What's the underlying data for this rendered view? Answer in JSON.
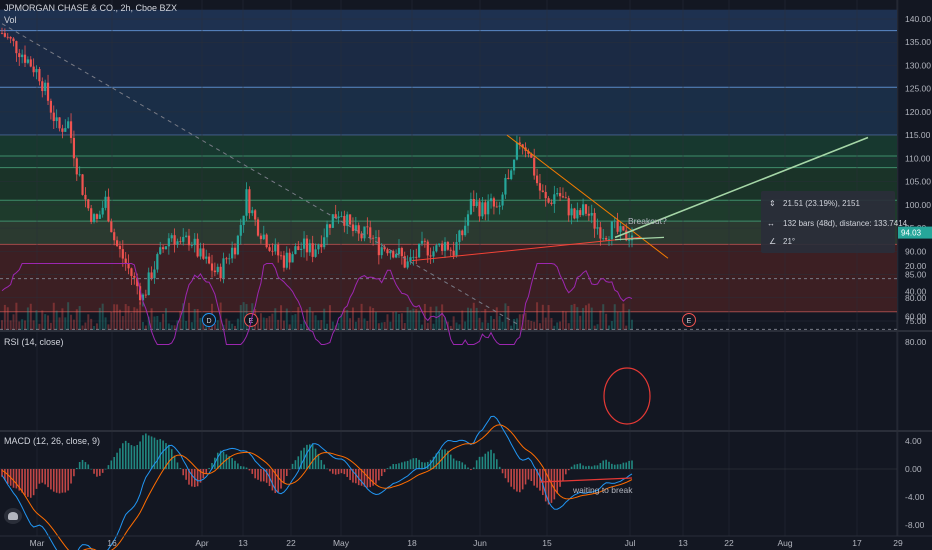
{
  "header": {
    "title": "JPMORGAN CHASE & CO., 2h, Cboe BZX",
    "volume_label": "Vol"
  },
  "rsi": {
    "label": "RSI (14, close)",
    "ticks": [
      "80.00",
      "60.00",
      "40.00",
      "20.00"
    ]
  },
  "macd": {
    "label": "MACD (12, 26, close, 9)",
    "ticks": [
      "4.00",
      "0.00",
      "-4.00",
      "-8.00"
    ],
    "annotation": "waiting to break"
  },
  "price_axis": {
    "ticks": [
      "140.00",
      "135.00",
      "130.00",
      "125.00",
      "120.00",
      "115.00",
      "110.00",
      "105.00",
      "100.00",
      "95.00",
      "90.00",
      "85.00",
      "80.00",
      "75.00"
    ],
    "last_price": "94.03"
  },
  "time_axis": {
    "ticks": [
      "Mar",
      "16",
      "Apr",
      "13",
      "22",
      "May",
      "18",
      "Jun",
      "15",
      "Jul",
      "13",
      "22",
      "Aug",
      "17",
      "29"
    ]
  },
  "annotations": {
    "breakout": "Breakout?"
  },
  "event_markers": [
    "D",
    "E",
    "E"
  ],
  "measure_box": {
    "line1": "21.51 (23.19%), 2151",
    "line2": "132 bars (48d), distance: 133.7414",
    "line3": "21°"
  },
  "colors": {
    "background": "#131722",
    "up": "#26a69a",
    "down": "#ef5350",
    "rsi_line": "#9c27b0",
    "macd_line": "#2196f3",
    "signal_line": "#ff6d00",
    "trend_green": "#a5d6a7",
    "trend_red": "#f44336"
  },
  "chart_data": {
    "type": "candlestick",
    "title": "JPMORGAN CHASE & CO., 2h, Cboe BZX",
    "ylim": [
      73,
      142
    ],
    "x_range": [
      "Mar",
      "29"
    ],
    "close_path": [
      [
        0,
        137
      ],
      [
        0.02,
        133
      ],
      [
        0.04,
        128
      ],
      [
        0.05,
        122
      ],
      [
        0.06,
        116
      ],
      [
        0.07,
        118
      ],
      [
        0.08,
        108
      ],
      [
        0.09,
        100
      ],
      [
        0.1,
        96
      ],
      [
        0.11,
        101
      ],
      [
        0.12,
        92
      ],
      [
        0.13,
        88
      ],
      [
        0.14,
        84
      ],
      [
        0.15,
        80
      ],
      [
        0.16,
        86
      ],
      [
        0.17,
        90
      ],
      [
        0.18,
        94
      ],
      [
        0.19,
        91
      ],
      [
        0.2,
        93
      ],
      [
        0.21,
        89
      ],
      [
        0.22,
        87
      ],
      [
        0.23,
        85
      ],
      [
        0.24,
        89
      ],
      [
        0.25,
        92
      ],
      [
        0.26,
        102
      ],
      [
        0.27,
        96
      ],
      [
        0.28,
        93
      ],
      [
        0.29,
        90
      ],
      [
        0.3,
        88
      ],
      [
        0.31,
        90
      ],
      [
        0.32,
        91
      ],
      [
        0.33,
        90
      ],
      [
        0.34,
        93
      ],
      [
        0.35,
        97
      ],
      [
        0.36,
        99
      ],
      [
        0.37,
        95
      ],
      [
        0.38,
        93
      ],
      [
        0.39,
        94
      ],
      [
        0.4,
        91
      ],
      [
        0.41,
        91
      ],
      [
        0.42,
        90
      ],
      [
        0.43,
        87
      ],
      [
        0.44,
        89
      ],
      [
        0.45,
        91
      ],
      [
        0.46,
        90
      ],
      [
        0.47,
        92
      ],
      [
        0.48,
        90
      ],
      [
        0.49,
        94
      ],
      [
        0.5,
        101
      ],
      [
        0.51,
        99
      ],
      [
        0.52,
        100
      ],
      [
        0.53,
        98
      ],
      [
        0.535,
        106
      ],
      [
        0.54,
        104
      ],
      [
        0.55,
        114
      ],
      [
        0.56,
        112
      ],
      [
        0.565,
        108
      ],
      [
        0.57,
        104
      ],
      [
        0.58,
        100
      ],
      [
        0.59,
        103
      ],
      [
        0.6,
        100
      ],
      [
        0.61,
        97
      ],
      [
        0.62,
        99
      ],
      [
        0.63,
        96
      ],
      [
        0.64,
        94
      ],
      [
        0.65,
        95
      ],
      [
        0.66,
        93
      ],
      [
        0.67,
        94
      ]
    ],
    "levels": [
      137.5,
      125.3,
      115,
      110.5,
      108,
      101,
      96.5,
      91.5,
      77
    ],
    "rsi": {
      "ylim": [
        0,
        90
      ],
      "bands": [
        70,
        30
      ]
    },
    "macd": {
      "ylim": [
        -8.5,
        5
      ]
    }
  }
}
